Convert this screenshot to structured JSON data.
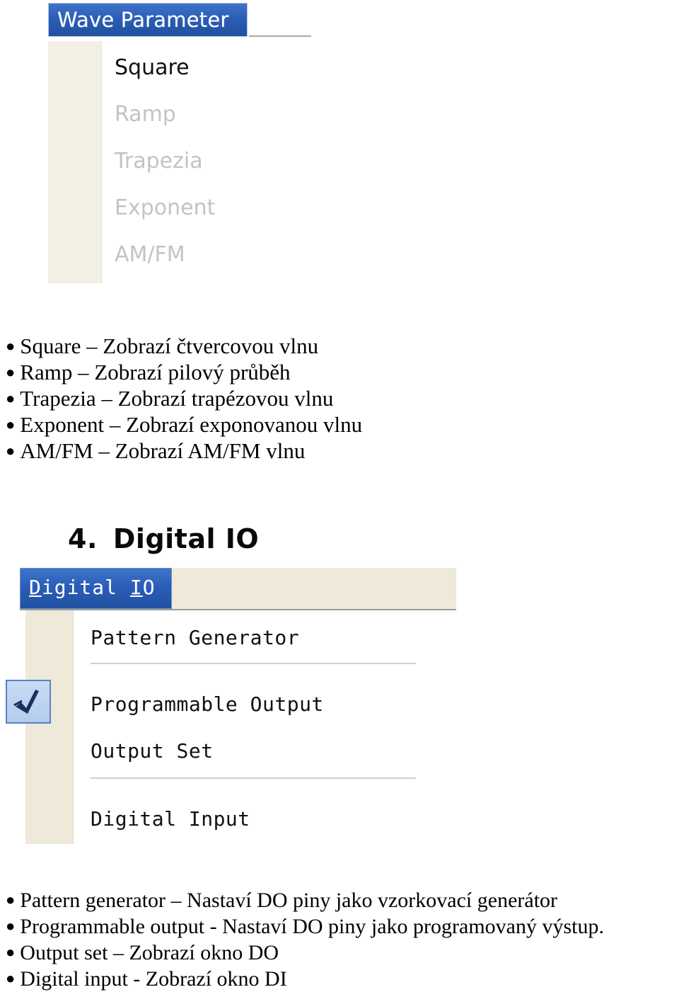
{
  "wave_parameter_menu": {
    "title": "Wave Parameter",
    "items": [
      {
        "label": "Square",
        "enabled": true
      },
      {
        "label": "Ramp",
        "enabled": false
      },
      {
        "label": "Trapezia",
        "enabled": false
      },
      {
        "label": "Exponent",
        "enabled": false
      },
      {
        "label": "AM/FM",
        "enabled": false
      }
    ]
  },
  "wave_bullets": [
    "Square – Zobrazí čtvercovou vlnu",
    "Ramp – Zobrazí pilový průběh",
    "Trapezia – Zobrazí trapézovou vlnu",
    "Exponent – Zobrazí exponovanou vlnu",
    "AM/FM – Zobrazí AM/FM vlnu"
  ],
  "digital_io_heading": {
    "number": "4.",
    "text": "Digital IO"
  },
  "digital_io_menu": {
    "tab_label": "Digital IO",
    "tab_mnemonic_1": "D",
    "tab_mnemonic_2": "I",
    "items": [
      {
        "label": "Pattern Generator",
        "checked": false
      },
      {
        "label": "Programmable Output",
        "checked": true
      },
      {
        "label": "Output Set",
        "checked": false
      },
      {
        "label": "Digital Input",
        "checked": false
      }
    ],
    "check_icon": "checkmark-icon"
  },
  "digital_io_bullets": [
    "Pattern generator – Nastaví DO piny jako vzorkovací generátor",
    "Programmable output -  Nastaví DO piny jako programovaný výstup.",
    "Output set – Zobrazí okno DO",
    "Digital input - Zobrazí okno DI"
  ],
  "colors": {
    "title_blue": "#2b5eb8",
    "panel_cream": "#f2efe4",
    "menu_cream": "#eee9d9",
    "check_box_blue": "#b4cdee",
    "disabled_text": "#c3c4c0"
  }
}
